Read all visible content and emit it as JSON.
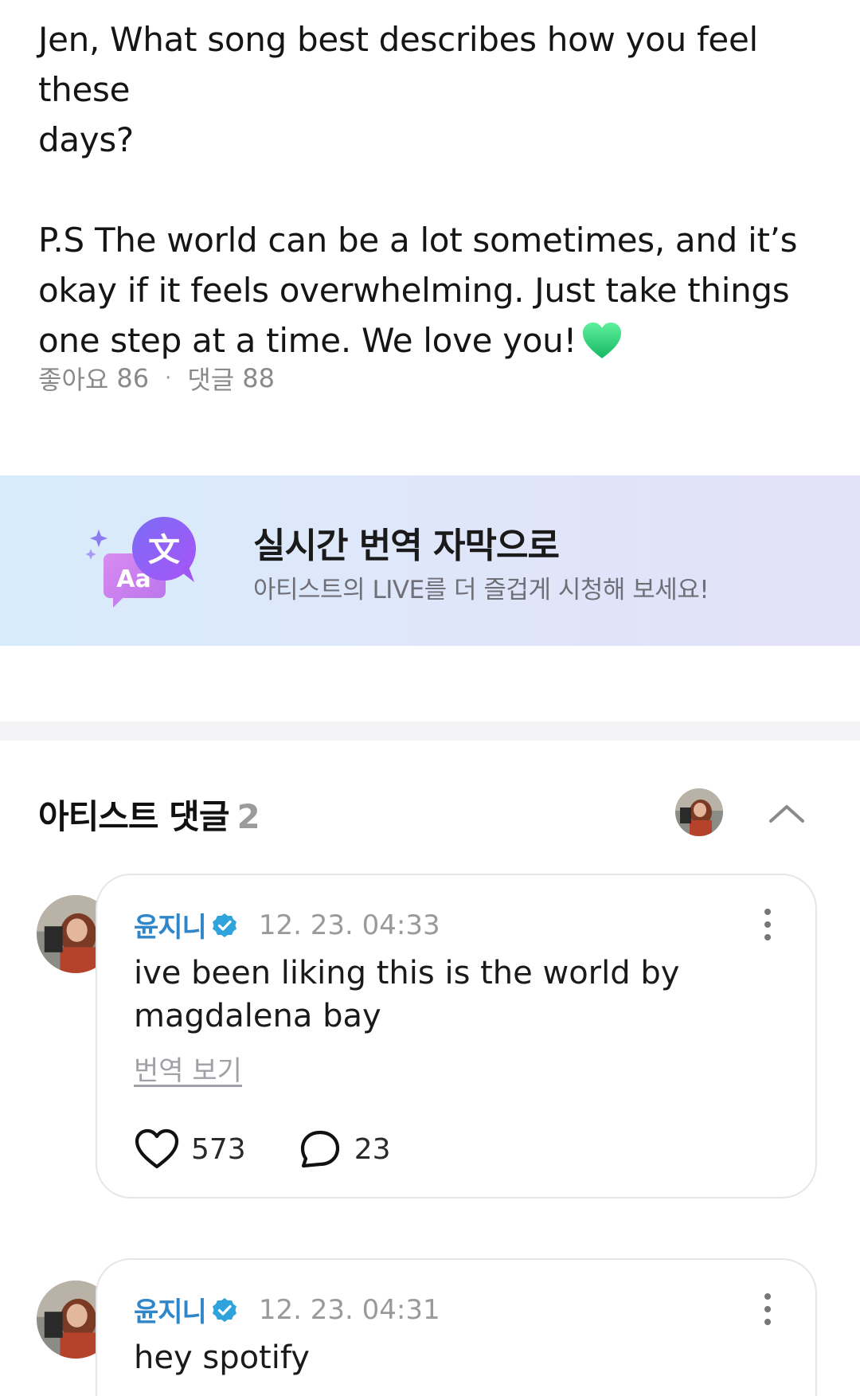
{
  "post": {
    "line1": "Jen, What song best describes how you feel these",
    "line2": "days?",
    "ps_line1": "P.S  The world can be a lot sometimes, and it’s",
    "ps_line2": "okay if it feels overwhelming. Just take things",
    "ps_line3": "one step at a time. We love you!",
    "emoji_icon": "green-heart-icon",
    "likes_label": "좋아요",
    "likes_count": "86",
    "separator": "·",
    "comments_label": "댓글",
    "comments_count": "88"
  },
  "banner": {
    "title": "실시간 번역 자막으로",
    "subtitle": "아티스트의 LIVE를 더 즐겁게 시청해 보세요!",
    "icon_glyph_main": "文",
    "icon_glyph_sub": "Aa",
    "icon_sparkle": "✦"
  },
  "artist_comments": {
    "title": "아티스트 댓글",
    "count": "2",
    "items": [
      {
        "author": "윤지니",
        "timestamp": "12. 23. 04:33",
        "text_line1": "ive been liking this is the world by",
        "text_line2": "magdalena bay",
        "translate_label": "번역 보기",
        "likes": "573",
        "replies": "23"
      },
      {
        "author": "윤지니",
        "timestamp": "12. 23. 04:31",
        "text_line1": "hey spotify"
      }
    ]
  },
  "colors": {
    "author_blue": "#2f86c9",
    "verified_blue": "#2fa4dc",
    "emoji_green": "#2ed47a",
    "banner_purple": "#8b5cf6"
  }
}
